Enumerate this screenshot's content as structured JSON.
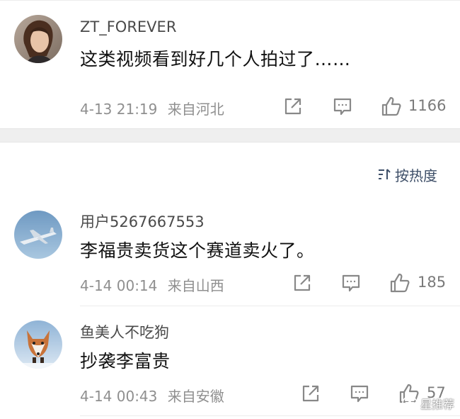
{
  "comments": [
    {
      "username": "ZT_FOREVER",
      "text": "这类视频看到好几个人拍过了……",
      "time": "4-13 21:19",
      "location": "来自河北",
      "likes": "1166",
      "avatar_icon": "woman-portrait-avatar"
    },
    {
      "username": "用户5267667553",
      "text": "李福贵卖货这个赛道卖火了。",
      "time": "4-14 00:14",
      "location": "来自山西",
      "likes": "185",
      "avatar_icon": "airplane-avatar"
    },
    {
      "username": "鱼美人不吃狗",
      "text": "抄袭李富贵",
      "time": "4-14 00:43",
      "location": "来自安徽",
      "likes": "57",
      "avatar_icon": "fox-avatar"
    }
  ],
  "sort": {
    "label": "按热度",
    "icon": "sort-icon"
  },
  "watermark": {
    "text": "星推荐"
  },
  "colors": {
    "accent_blue": "#3e4f68",
    "meta_gray": "#8f8f8f",
    "band_gray": "#efefef"
  }
}
